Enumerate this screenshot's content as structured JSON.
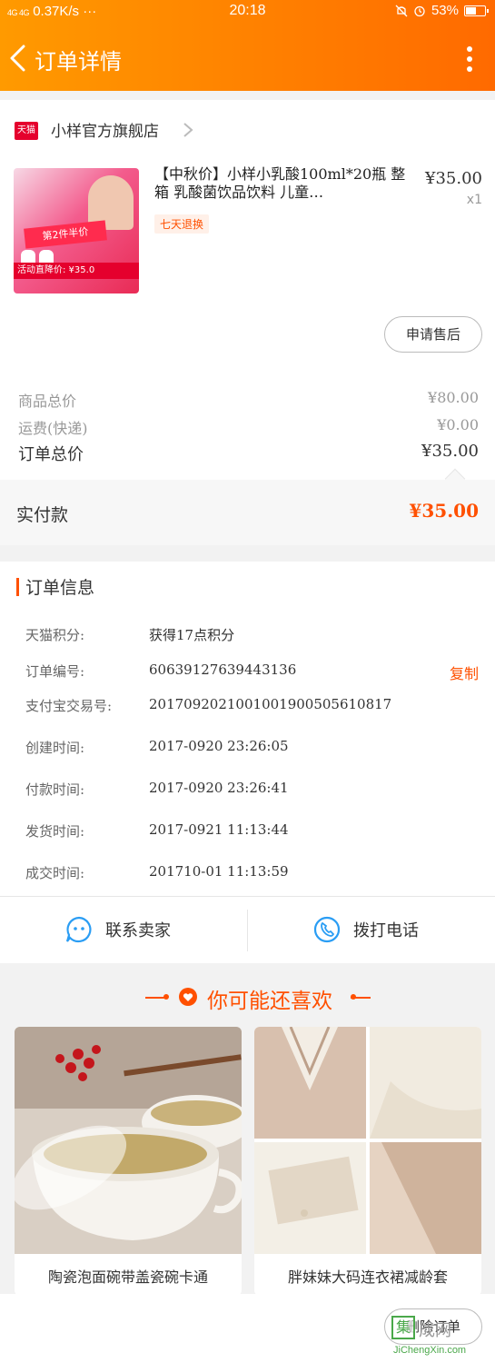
{
  "status_bar": {
    "network": "4G 4G",
    "speed": "0.37K/s ···",
    "time": "20:18",
    "battery": "53%",
    "battery_level": 0.53
  },
  "header": {
    "title": "订单详情"
  },
  "store": {
    "badge": "天猫",
    "name": "小样官方旗舰店",
    "product": {
      "title": "【中秋价】小样小乳酸100ml*20瓶 整箱 乳酸菌饮品饮料 儿童…",
      "price": "¥35.00",
      "qty": "x1",
      "tag": "七天退换",
      "image_banner": "第2件半价",
      "image_price": "活动直降价: ¥35.0"
    },
    "after_sale_button": "申请售后"
  },
  "summary": {
    "rows": [
      {
        "label": "商品总价",
        "value": "¥80.00"
      },
      {
        "label": "运费(快递)",
        "value": "¥0.00"
      },
      {
        "label": "订单总价",
        "value": "¥35.00"
      }
    ],
    "paid_label": "实付款",
    "paid_value": "¥35.00"
  },
  "order_info": {
    "title": "订单信息",
    "rows": [
      {
        "label": "天猫积分:",
        "value": "获得17点积分"
      },
      {
        "label": "订单编号:",
        "value": "60639127639443136",
        "action": "复制"
      },
      {
        "label": "支付宝交易号:",
        "value": "2017092021001001900505610817"
      },
      {
        "label": "创建时间:",
        "value": "2017-0920 23:26:05"
      },
      {
        "label": "付款时间:",
        "value": "2017-0920 23:26:41"
      },
      {
        "label": "发货时间:",
        "value": "2017-0921 11:13:44"
      },
      {
        "label": "成交时间:",
        "value": "201710-01 11:13:59"
      }
    ]
  },
  "contact": {
    "seller": "联系卖家",
    "call": "拨打电话"
  },
  "recommend": {
    "title": "你可能还喜欢",
    "items": [
      {
        "name": "陶瓷泡面碗带盖瓷碗卡通"
      },
      {
        "name": "胖妹妹大码连衣裙减龄套"
      }
    ]
  },
  "bottom": {
    "delete_button": "删除订单"
  },
  "watermark": {
    "icon": "集",
    "text": "成网",
    "site": "JiChengXin.com"
  },
  "colors": {
    "accent": "#ff5000",
    "header_start": "#ff9a00",
    "header_end": "#ff6a00",
    "tmall": "#e5002d"
  }
}
